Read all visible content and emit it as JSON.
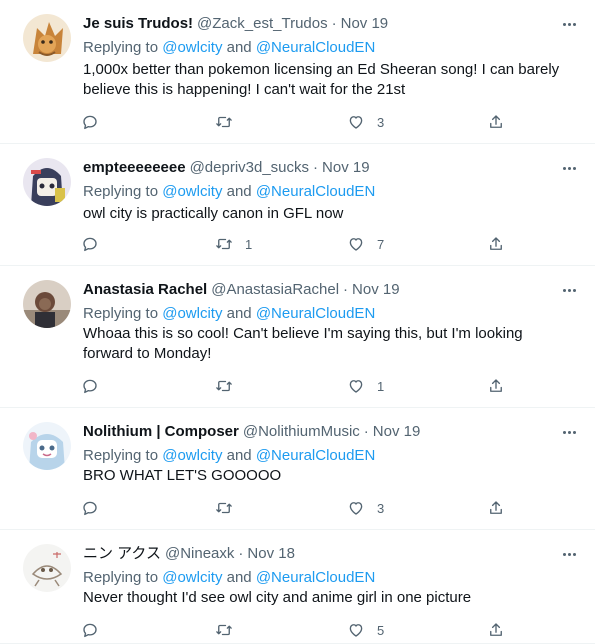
{
  "tweets": [
    {
      "name": "Je suis Trudos!",
      "handle": "@Zack_est_Trudos",
      "separator": "·",
      "date": "Nov 19",
      "replying_prefix": "Replying to ",
      "mention1": "@owlcity",
      "and": " and ",
      "mention2": "@NeuralCloudEN",
      "text": "1,000x better than pokemon licensing an Ed Sheeran song! I can barely believe this is happening! I can't wait for the 21st",
      "replies": "",
      "retweets": "",
      "likes": "3",
      "avatar_color": "#c8843a"
    },
    {
      "name": "empteeeeeeee",
      "handle": "@depriv3d_sucks",
      "separator": "·",
      "date": "Nov 19",
      "replying_prefix": "Replying to ",
      "mention1": "@owlcity",
      "and": " and ",
      "mention2": "@NeuralCloudEN",
      "text": "owl city is practically canon in GFL now",
      "replies": "",
      "retweets": "1",
      "likes": "7",
      "avatar_color": "#3a3f5c"
    },
    {
      "name": "Anastasia Rachel",
      "handle": "@AnastasiaRachel",
      "separator": "·",
      "date": "Nov 19",
      "replying_prefix": "Replying to ",
      "mention1": "@owlcity",
      "and": " and ",
      "mention2": "@NeuralCloudEN",
      "text": "Whoaa this is so cool! Can't believe I'm saying this, but I'm looking forward to Monday!",
      "replies": "",
      "retweets": "",
      "likes": "1",
      "avatar_color": "#6b4a3a"
    },
    {
      "name": "Nolithium | Composer",
      "handle": "@NolithiumMusic",
      "separator": "·",
      "date": "Nov 19",
      "replying_prefix": "Replying to ",
      "mention1": "@owlcity",
      "and": " and ",
      "mention2": "@NeuralCloudEN",
      "text": "BRO WHAT LET'S GOOOOO",
      "replies": "",
      "retweets": "",
      "likes": "3",
      "avatar_color": "#b8d4ea"
    },
    {
      "name": "ニン アクス",
      "handle": "@Nineaxk",
      "separator": "·",
      "date": "Nov 18",
      "replying_prefix": "Replying to ",
      "mention1": "@owlcity",
      "and": " and ",
      "mention2": "@NeuralCloudEN",
      "text": "Never thought I'd see owl city and anime girl in one picture",
      "replies": "",
      "retweets": "",
      "likes": "5",
      "avatar_color": "#f4f4f2"
    }
  ],
  "colors": {
    "link": "#1d9bf0",
    "secondary_text": "#536471",
    "primary_text": "#0f1419",
    "divider": "#eff3f4"
  },
  "icons": {
    "reply": "reply-icon",
    "retweet": "retweet-icon",
    "like": "like-icon",
    "share": "share-icon",
    "more": "more-icon"
  }
}
